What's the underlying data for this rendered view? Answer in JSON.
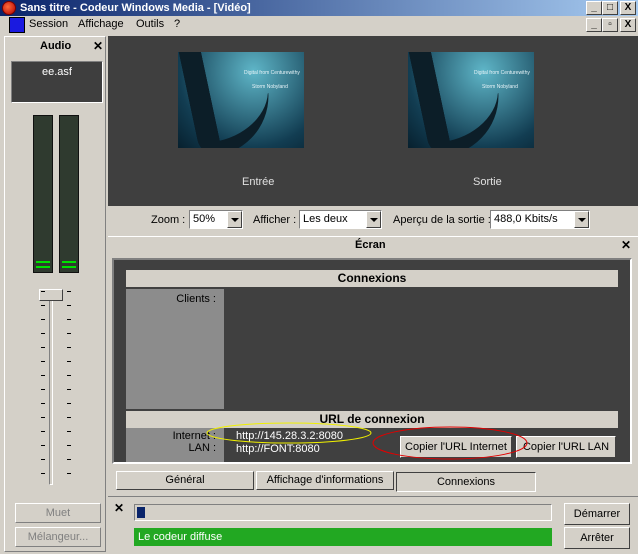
{
  "window": {
    "title": "Sans titre - Codeur Windows Media - [Vidéo]",
    "controls": {
      "minimize": "_",
      "maximize": "□",
      "close": "X"
    }
  },
  "menu": {
    "items": [
      "Session",
      "Affichage",
      "Outils",
      "?"
    ],
    "mdi_controls": {
      "minimize": "_",
      "restore": "▫",
      "close": "X"
    }
  },
  "audio_panel": {
    "title": "Audio",
    "close": "✕",
    "source": "ee.asf",
    "mute_label": "Muet",
    "mixer_label": "Mélangeur..."
  },
  "video": {
    "input_label": "Entrée",
    "output_label": "Sortie",
    "thumb_text_line1": "Digital from Centurewithy",
    "thumb_text_line2": "Storm Nobyland"
  },
  "toolbar": {
    "zoom_label": "Zoom :",
    "zoom_value": "50%",
    "show_label": "Afficher :",
    "show_value": "Les deux",
    "output_preview_label": "Aperçu de la sortie :",
    "output_preview_value": "488,0 Kbits/s"
  },
  "screen_panel": {
    "title": "Écran",
    "close": "✕",
    "connections_title": "Connexions",
    "clients_label": "Clients :",
    "url_title": "URL de connexion",
    "internet_label": "Internet :",
    "lan_label": "LAN :",
    "internet_url": "http://145.28.3.2:8080",
    "lan_url": "http://FONT:8080",
    "copy_internet_button": "Copier l'URL Internet",
    "copy_lan_button": "Copier l'URL LAN"
  },
  "tabs": [
    {
      "label": "Général",
      "active": false
    },
    {
      "label": "Affichage d'informations",
      "active": false
    },
    {
      "label": "Connexions",
      "active": true
    }
  ],
  "status": {
    "close": "✕",
    "progress_fraction": 0.02,
    "message": "Le codeur diffuse",
    "start_button": "Démarrer",
    "stop_button": "Arrêter"
  },
  "meters": {
    "left_level": 0.04,
    "right_level": 0.04,
    "volume_position": 0.0
  },
  "colors": {
    "status_green": "#22a822",
    "meter_green": "#00e000",
    "title_blue": "#0a246a"
  }
}
